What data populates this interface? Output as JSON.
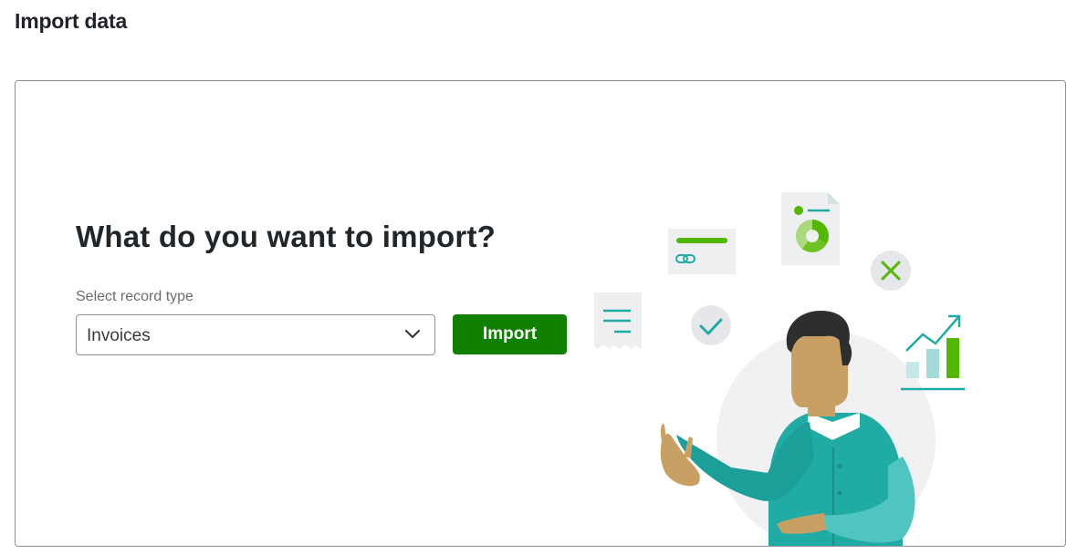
{
  "page": {
    "title": "Import data"
  },
  "import_panel": {
    "heading": "What do you want to import?",
    "record_type_label": "Select record type",
    "record_type_value": "Invoices",
    "import_button_label": "Import"
  },
  "illustration": {
    "icons": [
      "receipt-icon",
      "link-card-icon",
      "pie-chart-document-icon",
      "checkmark-icon",
      "close-x-icon",
      "growth-chart-icon",
      "person-pointing-illustration"
    ]
  },
  "colors": {
    "primary_button": "#108000",
    "teal_accent": "#21aba5",
    "green_accent": "#53b700",
    "text_dark": "#21262a"
  }
}
